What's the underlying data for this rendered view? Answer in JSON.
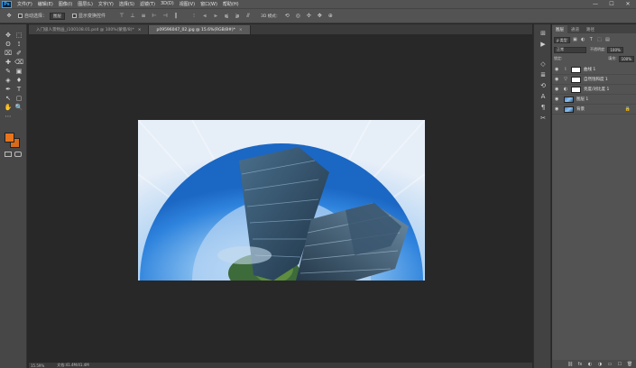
{
  "app": {
    "logo": "Ps"
  },
  "menu": [
    "文件(F)",
    "编辑(E)",
    "图像(I)",
    "图层(L)",
    "文字(Y)",
    "选择(S)",
    "滤镜(T)",
    "3D(D)",
    "视图(V)",
    "窗口(W)",
    "帮助(H)"
  ],
  "window_controls": [
    "—",
    "☐",
    "✕"
  ],
  "options": {
    "move_icon": "✥",
    "auto_select_label": "自动选择：",
    "auto_select_value": "图层",
    "show_transform_label": "显示变换控件",
    "align_icons": [
      "⊤",
      "⊥",
      "≡",
      "⊢",
      "⊣",
      "‖"
    ],
    "distribute_icons": [
      "⫶",
      "⫷",
      "⫸",
      "⫹",
      "⫺",
      "⫻"
    ],
    "mode3d_label": "3D 模式：",
    "mode3d_icons": [
      "⟲",
      "◎",
      "✣",
      "✥",
      "⊕"
    ]
  },
  "doc_tabs": [
    {
      "title": "入门级人景物画_(100108.01.psd @ 100%(蒙版/8)*",
      "close": "×",
      "active": false
    },
    {
      "title": "p09596047_02.jpg @ 15.6%(RGB/8#)*",
      "close": "×",
      "active": true
    }
  ],
  "tools": [
    "✥",
    "⬚",
    "ʘ",
    "⟟",
    "⌧",
    "✐",
    "✚",
    "⌫",
    "✎",
    "▣",
    "◈",
    "♦",
    "✒",
    "T",
    "↖",
    "▢",
    "✋",
    "🔍",
    "⋯"
  ],
  "colors": {
    "foreground": "#e8741e",
    "background": "#d86a1c",
    "accent": "#31a8ff"
  },
  "status": {
    "zoom": "15.59%",
    "doc_info": "文档:41.4M/41.4M"
  },
  "right_strip_icons": [
    "⊞",
    "▶",
    "◇",
    "≣",
    "⟲",
    "A",
    "¶",
    "✂"
  ],
  "panel": {
    "tabs": [
      "图层",
      "通道",
      "路径"
    ],
    "filter_label": "ρ 类型",
    "filter_icons": [
      "▣",
      "◐",
      "T",
      "⬚",
      "▤"
    ],
    "blend_mode": "正常",
    "opacity_label": "不透明度:",
    "opacity_value": "100%",
    "lock_label": "锁定:",
    "fill_label": "填充:",
    "fill_value": "100%",
    "layers": [
      {
        "name": "曲线 1",
        "kind": "adjust",
        "icon": "⌇"
      },
      {
        "name": "自然饱和度 1",
        "kind": "adjust",
        "icon": "▽"
      },
      {
        "name": "亮度/对比度 1",
        "kind": "adjust",
        "icon": "◐"
      },
      {
        "name": "图层 1",
        "kind": "image",
        "icon": ""
      },
      {
        "name": "背景",
        "kind": "image",
        "icon": "",
        "locked": true,
        "lock_icon": "🔒"
      }
    ],
    "footer_icons": [
      "⛓",
      "fx",
      "◐",
      "◑",
      "▭",
      "☐",
      "🗑"
    ]
  }
}
